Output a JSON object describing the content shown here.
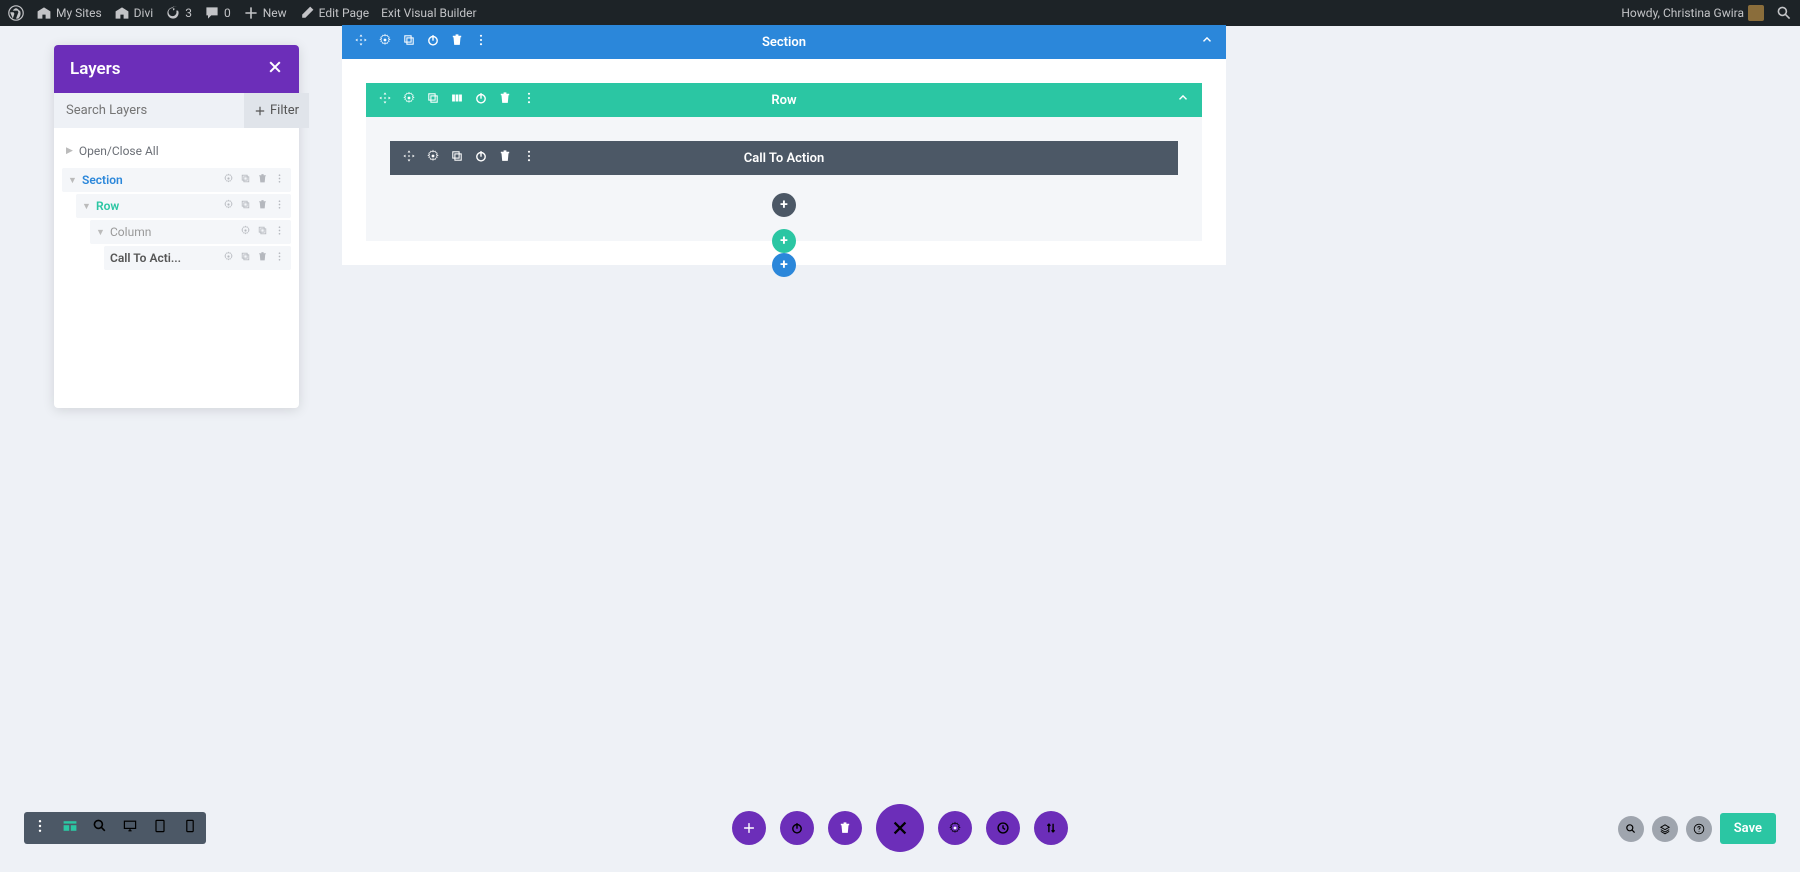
{
  "adminbar": {
    "my_sites": "My Sites",
    "divi": "Divi",
    "updates": "3",
    "comments": "0",
    "new": "New",
    "edit_page": "Edit Page",
    "exit_vb": "Exit Visual Builder",
    "howdy": "Howdy, Christina Gwira"
  },
  "layers": {
    "title": "Layers",
    "search_placeholder": "Search Layers",
    "filter": "Filter",
    "open_close": "Open/Close All",
    "items": {
      "section": "Section",
      "row": "Row",
      "column": "Column",
      "module": "Call To Acti..."
    }
  },
  "canvas": {
    "section": "Section",
    "row": "Row",
    "module": "Call To Action"
  },
  "bottom": {
    "save": "Save"
  }
}
